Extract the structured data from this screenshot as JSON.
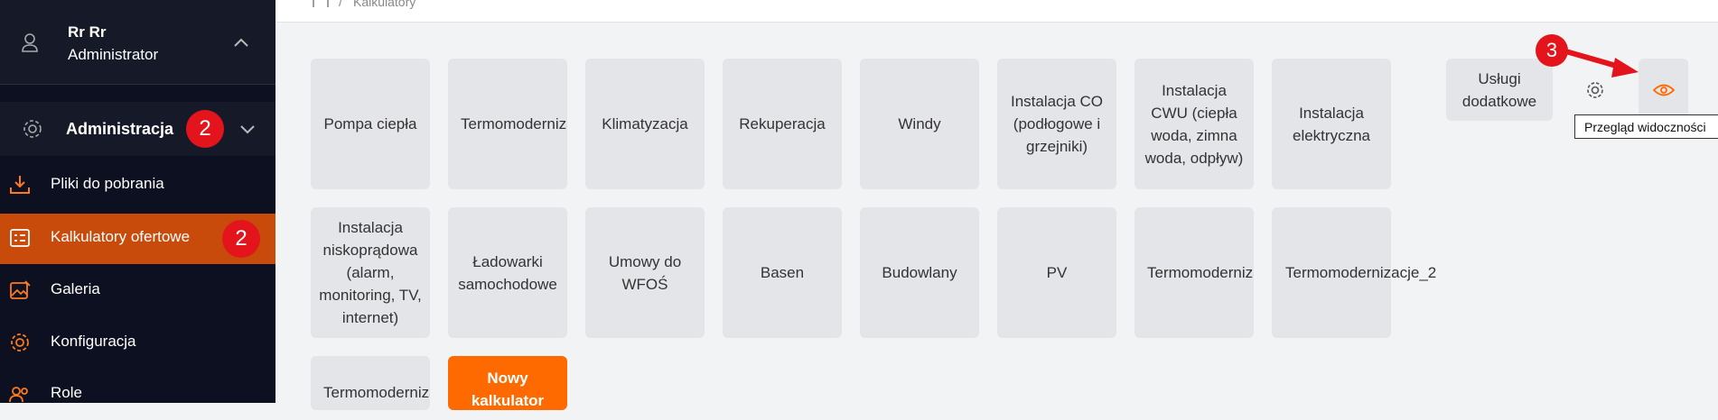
{
  "user": {
    "name": "Rr Rr",
    "role": "Administrator"
  },
  "admin": {
    "label": "Administracja",
    "badge": "2"
  },
  "nav": [
    {
      "label": "Pliki do pobrania",
      "icon": "download-icon"
    },
    {
      "label": "Kalkulatory ofertowe",
      "icon": "calculator-list-icon",
      "badge": "2",
      "active": true
    },
    {
      "label": "Galeria",
      "icon": "image-edit-icon"
    },
    {
      "label": "Konfiguracja",
      "icon": "gear-icon"
    },
    {
      "label": "Role",
      "icon": "users-icon"
    }
  ],
  "breadcrumb": {
    "separator": "/",
    "label": "Kalkulatory"
  },
  "tiles": [
    "Pompa ciepła",
    "Termomodernizacja",
    "Klimatyzacja",
    "Rekuperacja",
    "Windy",
    "Instalacja CO (podłogowe i grzejniki)",
    "Instalacja CWU (ciepła woda, zimna woda, odpływ)",
    "Instalacja elektryczna",
    "Instalacja niskoprądowa (alarm, monitoring, TV, internet)",
    "Ładowarki samochodowe",
    "Umowy do WFOŚ",
    "Basen",
    "Budowlany",
    "PV",
    "Termomodernizacja",
    "Termomodernizacje_2",
    "Termomodernizacja",
    "Nowy kalkulator"
  ],
  "actions": {
    "extra_services": "Usługi dodatkowe",
    "tooltip": "Przegląd widoczności",
    "callout": "3"
  },
  "colors": {
    "sidebar": "#0d1020",
    "active": "#c84b0c",
    "accent": "#ff6a00",
    "badge": "#e3141b"
  }
}
